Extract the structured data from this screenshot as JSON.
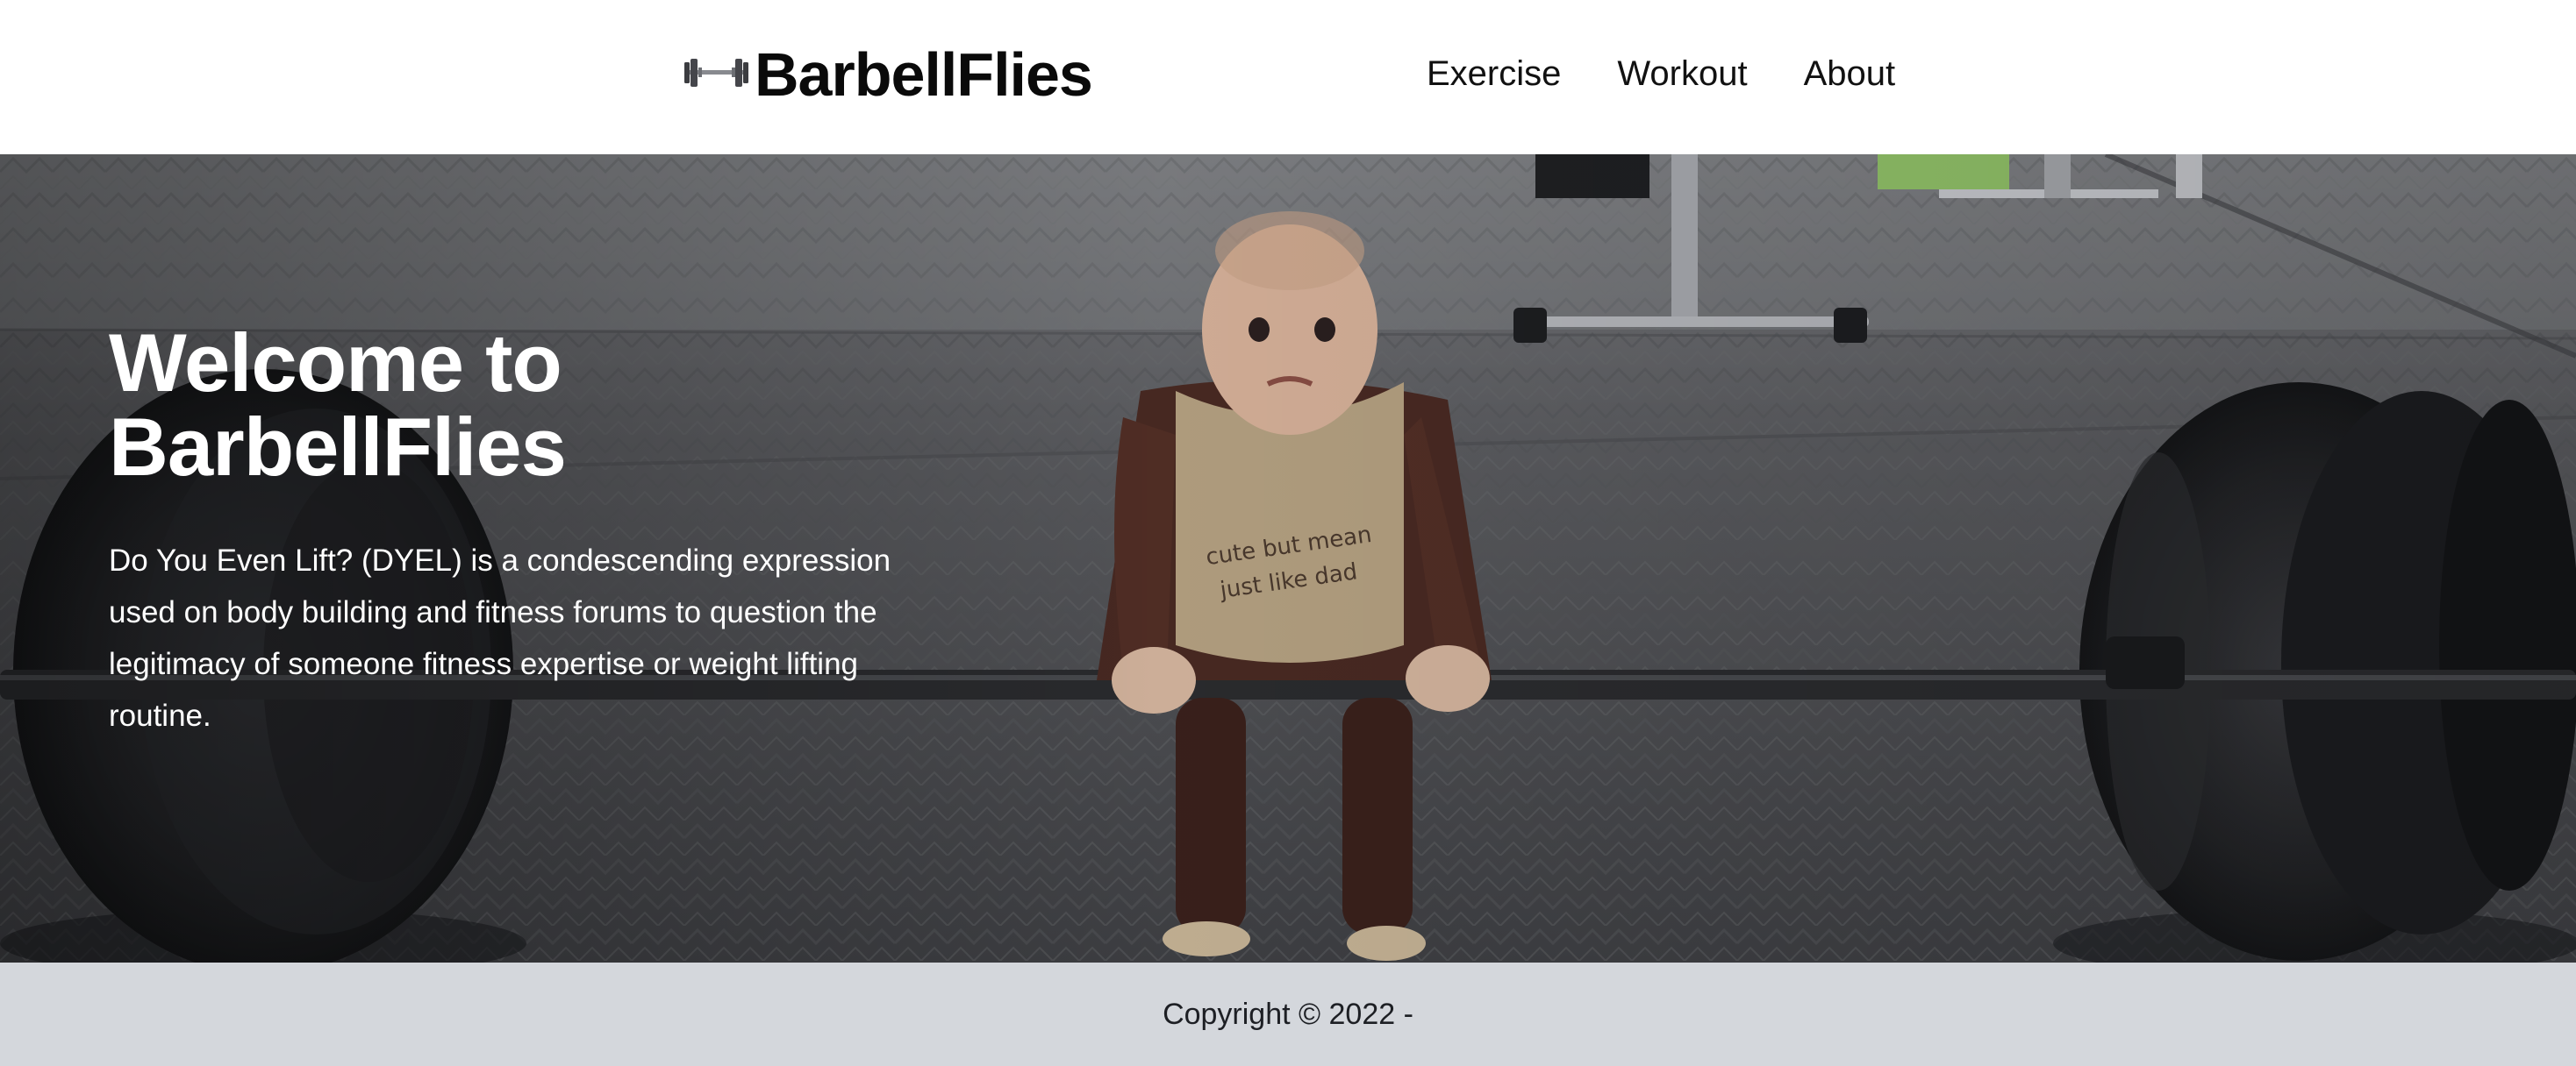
{
  "header": {
    "brand": {
      "logo_icon": "barbell-icon",
      "name": "BarbellFlies"
    },
    "nav": {
      "items": [
        {
          "label": "Exercise"
        },
        {
          "label": "Workout"
        },
        {
          "label": "About"
        }
      ]
    }
  },
  "hero": {
    "title_line1": "Welcome to",
    "title_line2": "BarbellFlies",
    "description": "Do You Even Lift? (DYEL) is a condescending expression used on body building and fitness forums to question the legitimacy of someone fitness expertise or weight lifting routine.",
    "background_image": "baby-deadlifting-barbell-photo"
  },
  "footer": {
    "copyright": "Copyright © 2022 -"
  },
  "colors": {
    "header_bg": "#ffffff",
    "footer_bg": "#d4d7dc",
    "hero_text": "#ffffff",
    "brand_text": "#0a0a0a"
  }
}
